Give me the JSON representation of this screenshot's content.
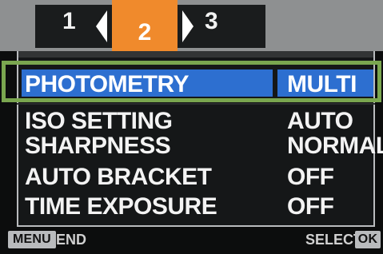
{
  "tabs": {
    "tab1": "1",
    "tab2": "2",
    "tab3": "3"
  },
  "menu": {
    "items": [
      {
        "label": "PHOTOMETRY",
        "value": "MULTI"
      },
      {
        "label": "ISO SETTING",
        "value": "AUTO"
      },
      {
        "label": "SHARPNESS",
        "value": "NORMAL"
      },
      {
        "label": "AUTO BRACKET",
        "value": "OFF"
      },
      {
        "label": "TIME EXPOSURE",
        "value": "OFF"
      }
    ]
  },
  "footer": {
    "menu_key": "MENU",
    "end": "END",
    "select": "SELECT",
    "ok_key": "OK"
  },
  "colors": {
    "active_tab": "#f08a2c",
    "selection_fill": "#2d6fd0",
    "outline": "#7aa64f"
  }
}
